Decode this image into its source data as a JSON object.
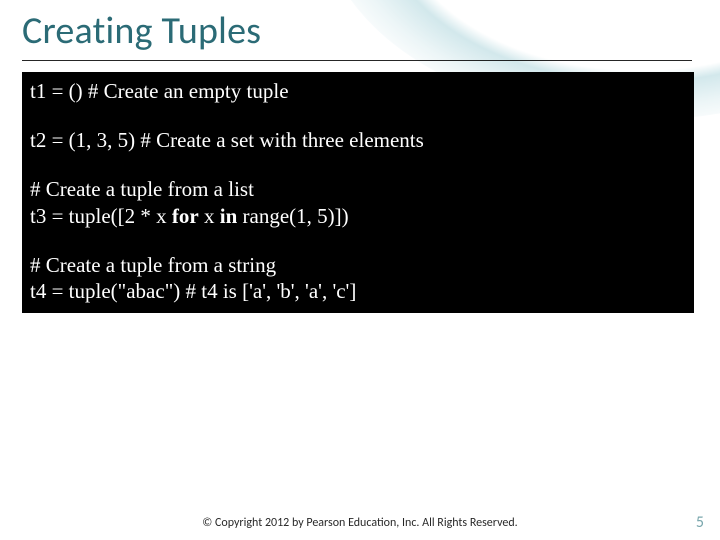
{
  "title": "Creating Tuples",
  "code": {
    "l1": "t1 = () # Create an empty tuple",
    "l2": "t2 = (1, 3, 5) # Create a set with three elements",
    "l3": "# Create a tuple from a list",
    "l4a": "t3 = tuple([2 * x ",
    "l4b": "for",
    "l4c": " x ",
    "l4d": "in",
    "l4e": " range(1, 5)])",
    "l5": "# Create a tuple from a string",
    "l6": "t4 = tuple(\"abac\") # t4 is ['a', 'b', 'a', 'c']"
  },
  "footer": "© Copyright 2012 by Pearson Education, Inc. All Rights Reserved.",
  "page_number": "5"
}
